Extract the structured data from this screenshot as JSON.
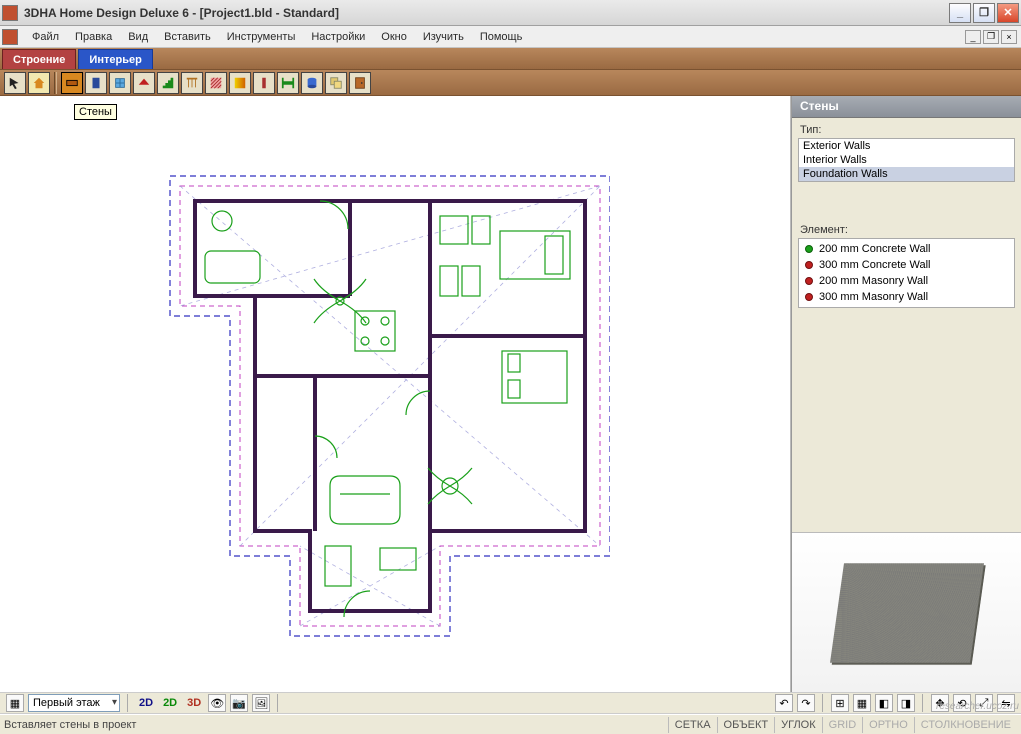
{
  "title": "3DHA Home Design Deluxe 6 - [Project1.bld - Standard]",
  "menu": [
    "Файл",
    "Правка",
    "Вид",
    "Вставить",
    "Инструменты",
    "Настройки",
    "Окно",
    "Изучить",
    "Помощь"
  ],
  "tabs": {
    "active": "Строение",
    "inactive": "Интерьер"
  },
  "tooltip": "Стены",
  "sidepanel": {
    "header": "Стены",
    "type_label": "Тип:",
    "types": [
      "Exterior Walls",
      "Interior Walls",
      "Foundation Walls"
    ],
    "selected_type_index": 2,
    "element_label": "Элемент:",
    "elements": [
      {
        "color": "green",
        "label": "200 mm Concrete Wall"
      },
      {
        "color": "red",
        "label": "300 mm Concrete Wall"
      },
      {
        "color": "red",
        "label": "200 mm Masonry Wall"
      },
      {
        "color": "red",
        "label": "300 mm Masonry Wall"
      }
    ]
  },
  "bottom": {
    "floor_label": "Первый этаж",
    "btn_2d": "2D",
    "btn_2dg": "2D",
    "btn_3d": "3D"
  },
  "status": {
    "left": "Вставляет стены в проект",
    "cells": [
      "СЕТКА",
      "ОБЪЕКТ",
      "УГЛОК",
      "GRID",
      "ОРТНО",
      "СТОЛКНОВЕНИЕ"
    ],
    "dim_indices": [
      3,
      4,
      5
    ]
  },
  "watermark": "researcher.ucoz.ru",
  "toolbar_icons": [
    "pointer-icon",
    "house-icon",
    "wall-icon",
    "door-icon",
    "window-icon",
    "roof-icon",
    "stairs-icon",
    "rail-icon",
    "hatch-icon",
    "gradient-icon",
    "column-icon",
    "beam-icon",
    "pillar-icon",
    "copy-icon",
    "door2-icon"
  ]
}
